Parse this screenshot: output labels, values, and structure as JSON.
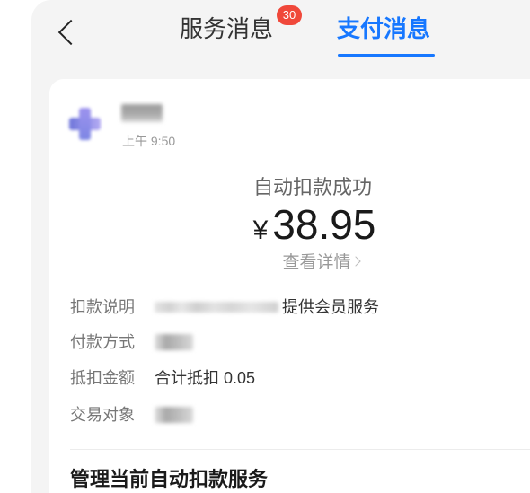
{
  "header": {
    "back_icon": "chevron-left-icon",
    "tabs": [
      {
        "label": "服务消息",
        "badge": "30",
        "active": false
      },
      {
        "label": "支付消息",
        "active": true
      }
    ]
  },
  "message": {
    "time": "上午 9:50",
    "status": "自动扣款成功",
    "currency": "¥",
    "amount": "38.95",
    "details_link": "查看详情",
    "details_icon": "chevron-right-icon",
    "rows": [
      {
        "label": "扣款说明",
        "value": "提供会员服务"
      },
      {
        "label": "付款方式"
      },
      {
        "label": "抵扣金额",
        "value": "合计抵扣 0.05"
      },
      {
        "label": "交易对象"
      }
    ],
    "manage_title": "管理当前自动扣款服务"
  },
  "colors": {
    "accent": "#1677ff",
    "badge": "#f0483a",
    "background": "#f4f4f4",
    "card": "#ffffff"
  }
}
